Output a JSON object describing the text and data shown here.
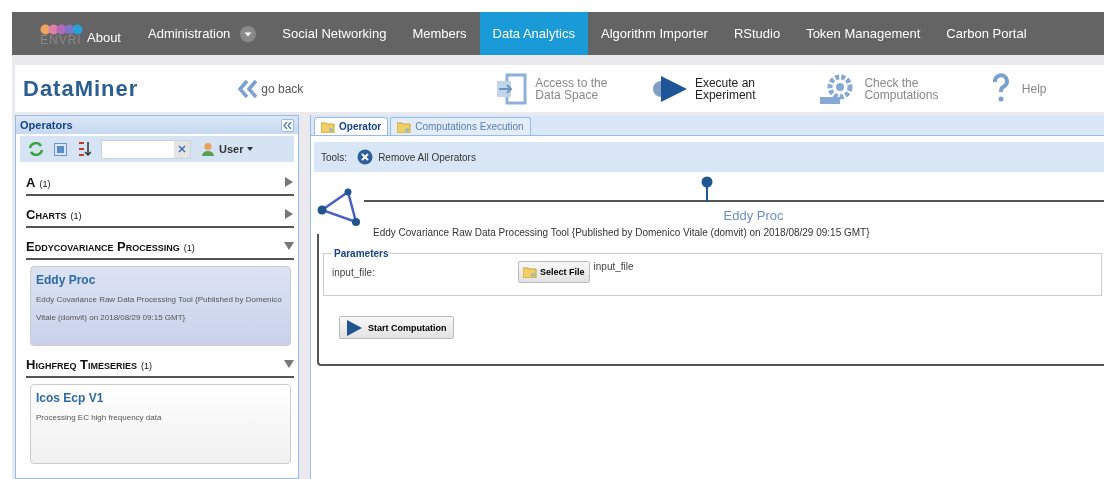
{
  "nav": {
    "logo_text": "ENVRI",
    "about": "About",
    "items": [
      {
        "label": "Administration",
        "selected": false,
        "dropdown": true
      },
      {
        "label": "Social Networking",
        "selected": false,
        "dropdown": false
      },
      {
        "label": "Members",
        "selected": false,
        "dropdown": false
      },
      {
        "label": "Data Analytics",
        "selected": true,
        "dropdown": false
      },
      {
        "label": "Algorithm Importer",
        "selected": false,
        "dropdown": false
      },
      {
        "label": "RStudio",
        "selected": false,
        "dropdown": false
      },
      {
        "label": "Token Management",
        "selected": false,
        "dropdown": false
      },
      {
        "label": "Carbon Portal",
        "selected": false,
        "dropdown": false
      }
    ]
  },
  "header": {
    "logo": "DataMiner",
    "go_back": "go back",
    "tools": [
      {
        "kind": "data",
        "label": "Access to the Data Space",
        "selected": false
      },
      {
        "kind": "execute",
        "label": "Execute an Experiment",
        "selected": true
      },
      {
        "kind": "check",
        "label": "Check the Computations",
        "selected": false
      },
      {
        "kind": "help",
        "label": "Help",
        "selected": false
      }
    ]
  },
  "operators_panel": {
    "title": "Operators",
    "user_menu": "User",
    "categories": [
      {
        "name": "A",
        "count": "(1)",
        "expanded": false
      },
      {
        "name": "Charts",
        "count": "(1)",
        "expanded": false
      },
      {
        "name": "Eddycovariance Processing",
        "count": "(1)",
        "expanded": true,
        "operators": [
          {
            "name": "Eddy Proc",
            "description": "Eddy Covariance Raw Data Processing Tool {Published by Domenico Vitale (domvit) on 2018/08/29 09:15 GMT}",
            "selected": true
          }
        ]
      },
      {
        "name": "Highfreq Timeseries",
        "count": "(1)",
        "expanded": true,
        "operators": [
          {
            "name": "Icos Ecp V1",
            "description": "Processing EC high frequency data",
            "selected": false
          }
        ]
      }
    ]
  },
  "main": {
    "tabs": [
      {
        "label": "Operator",
        "selected": true
      },
      {
        "label": "Computations Execution",
        "selected": false
      }
    ],
    "tools_label": "Tools:",
    "remove_all": "Remove All Operators",
    "operator": {
      "title": "Eddy Proc",
      "description": "Eddy Covariance Raw Data Processing Tool {Published by Domenico Vitale (domvit) on 2018/08/29 09:15 GMT}",
      "parameters_title": "Parameters",
      "parameters": [
        {
          "label": "input_file:",
          "button": "Select File",
          "value": "input_file"
        }
      ],
      "start": "Start Computation"
    }
  }
}
